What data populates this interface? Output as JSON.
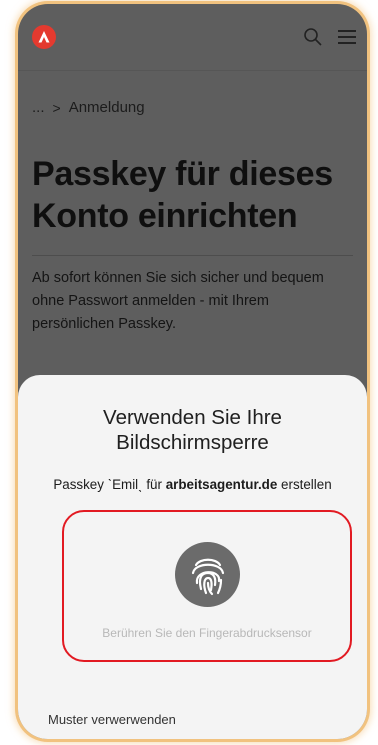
{
  "app_bar": {
    "logo": "agentur-logo",
    "icons": [
      "search-icon",
      "menu-icon"
    ]
  },
  "breadcrumb": {
    "ellipsis": "...",
    "separator": ">",
    "current": "Anmeldung"
  },
  "page": {
    "title": "Passkey für dieses Konto einrichten",
    "description": "Ab sofort können Sie sich sicher und bequem ohne Passwort anmelden - mit Ihrem persönlichen Passkey."
  },
  "sheet": {
    "title": "Verwenden Sie Ihre Bildschirmsperre",
    "subtitle_prefix": "Passkey ˋEmilˎ für ",
    "subtitle_domain": "arbeitsagentur.de",
    "subtitle_suffix": " erstellen",
    "fingerprint_hint": "Berühren Sie den Fingerabdrucksensor",
    "pattern_link": "Muster verwerwenden"
  },
  "colors": {
    "dim_background": "#5e5e5e",
    "sheet_background": "#f4f4f4",
    "highlight_border": "#e21a22",
    "logo_red": "#e43a2f",
    "device_frame": "#f1c27f"
  }
}
